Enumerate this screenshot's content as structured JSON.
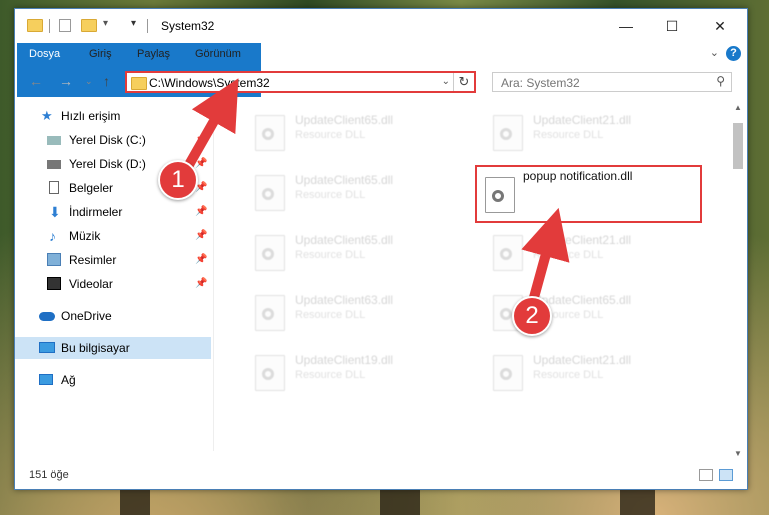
{
  "window": {
    "title": "System32"
  },
  "ribbon": {
    "tabs": [
      "Dosya",
      "Giriş",
      "Paylaş",
      "Görünüm"
    ]
  },
  "address": {
    "path": "C:\\Windows\\System32",
    "search_placeholder": "Ara: System32"
  },
  "sidebar": {
    "items": [
      {
        "label": "Hızlı erişim",
        "icon": "star-icon"
      },
      {
        "label": "Yerel Disk (C:)",
        "icon": "drive-icon"
      },
      {
        "label": "Yerel Disk (D:)",
        "icon": "drive-icon"
      },
      {
        "label": "Belgeler",
        "icon": "document-icon"
      },
      {
        "label": "İndirmeler",
        "icon": "download-icon"
      },
      {
        "label": "Müzik",
        "icon": "music-icon"
      },
      {
        "label": "Resimler",
        "icon": "pictures-icon"
      },
      {
        "label": "Videolar",
        "icon": "video-icon"
      },
      {
        "label": "OneDrive",
        "icon": "cloud-icon"
      },
      {
        "label": "Bu bilgisayar",
        "icon": "computer-icon"
      },
      {
        "label": "Ağ",
        "icon": "network-icon"
      }
    ]
  },
  "files": [
    {
      "name": "UpdateClient65.dll",
      "type": "Resource DLL"
    },
    {
      "name": "UpdateClient21.dll",
      "type": "Resource DLL"
    },
    {
      "name": "UpdateClient65.dll",
      "type": "Resource DLL"
    },
    {
      "name": "popup notification.dll",
      "type": ""
    },
    {
      "name": "UpdateClient65.dll",
      "type": "Resource DLL"
    },
    {
      "name": "UpdateClient21.dll",
      "type": "Resource DLL"
    },
    {
      "name": "UpdateClient63.dll",
      "type": "Resource DLL"
    },
    {
      "name": "UpdateClient65.dll",
      "type": "Resource DLL"
    },
    {
      "name": "UpdateClient19.dll",
      "type": "Resource DLL"
    },
    {
      "name": "UpdateClient21.dll",
      "type": "Resource DLL"
    }
  ],
  "status": {
    "item_count": "151 öğe"
  },
  "callouts": {
    "step1": "1",
    "step2": "2"
  },
  "colors": {
    "accent": "#1979ca",
    "highlight": "#e23b3b",
    "selected": "#cce3f6"
  }
}
